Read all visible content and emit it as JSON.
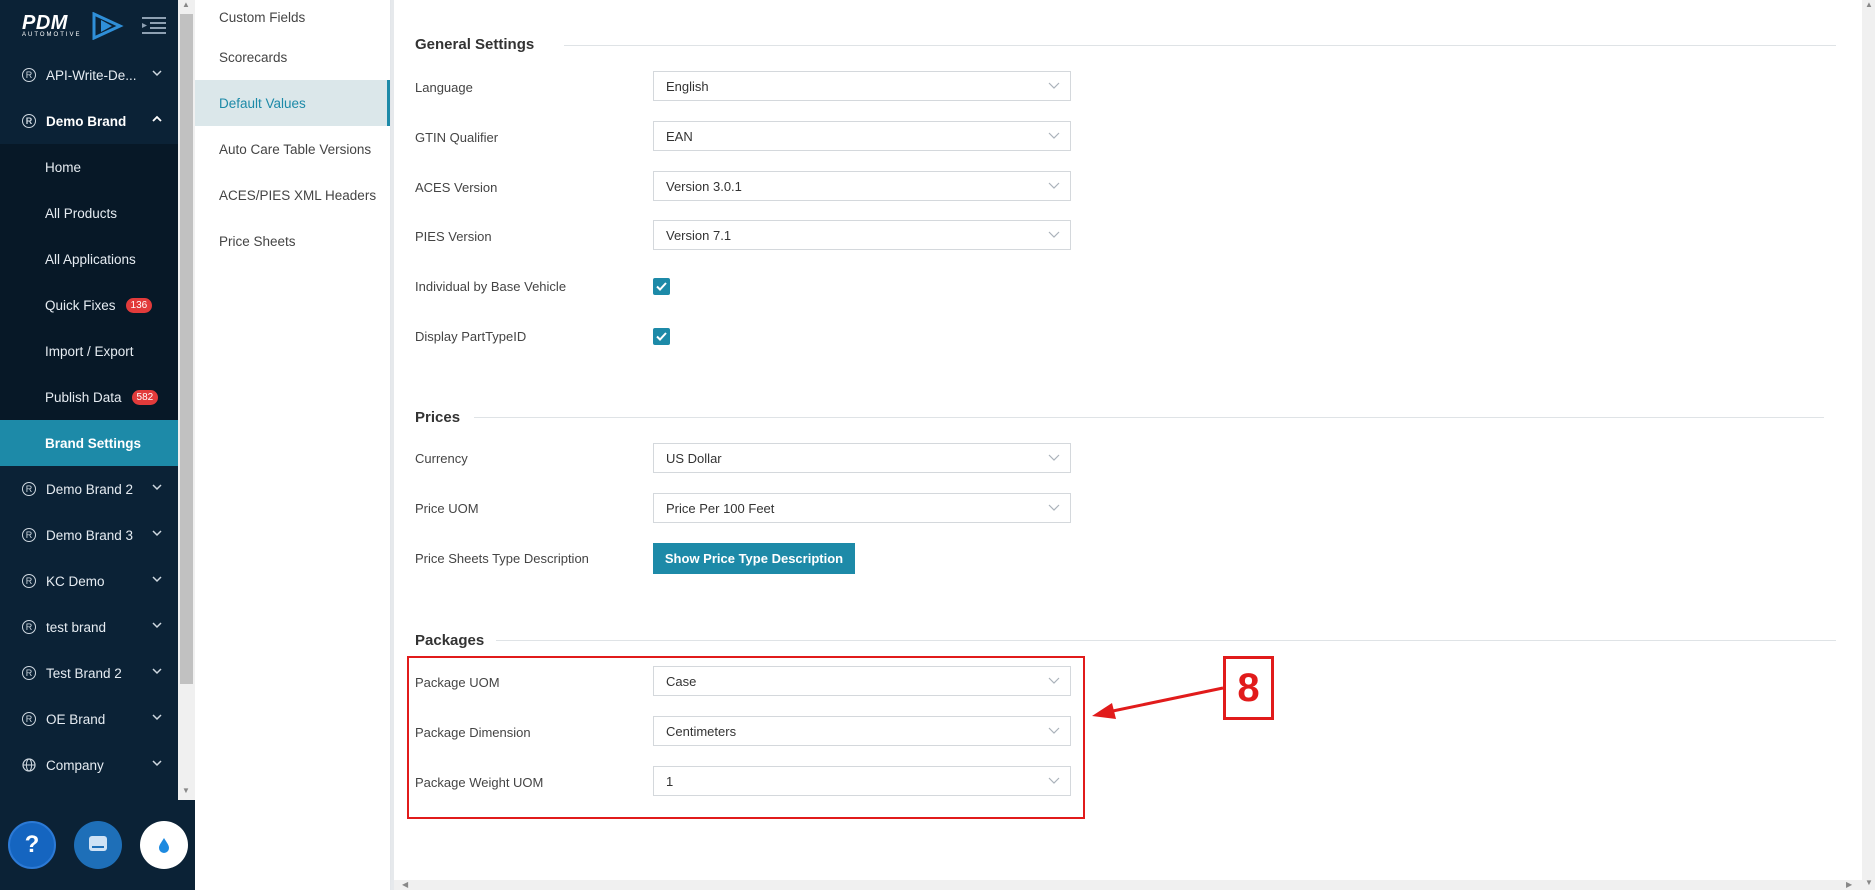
{
  "brand": {
    "logo_text": "PDM",
    "logo_sub": "AUTOMOTIVE"
  },
  "sidebar": {
    "brands_before": [
      {
        "label": "API-Write-De..."
      }
    ],
    "expanded_brand": {
      "label": "Demo Brand"
    },
    "sub_items": [
      {
        "label": "Home"
      },
      {
        "label": "All Products"
      },
      {
        "label": "All Applications"
      },
      {
        "label": "Quick Fixes",
        "badge": "136"
      },
      {
        "label": "Import / Export"
      },
      {
        "label": "Publish Data",
        "badge": "582"
      },
      {
        "label": "Brand Settings",
        "active": true
      }
    ],
    "brands_after": [
      {
        "label": "Demo Brand 2"
      },
      {
        "label": "Demo Brand 3"
      },
      {
        "label": "KC Demo"
      },
      {
        "label": "test brand"
      },
      {
        "label": "Test Brand 2"
      },
      {
        "label": "OE Brand"
      }
    ],
    "company": {
      "label": "Company"
    },
    "footer": {
      "help_label": "?"
    }
  },
  "submenu": {
    "items": [
      {
        "label": "Custom Fields"
      },
      {
        "label": "Scorecards"
      },
      {
        "label": "Default Values",
        "active": true
      },
      {
        "label": "Auto Care Table Versions"
      },
      {
        "label": "ACES/PIES XML Headers"
      },
      {
        "label": "Price Sheets"
      }
    ]
  },
  "general": {
    "title": "General Settings",
    "language_label": "Language",
    "language_value": "English",
    "gtin_label": "GTIN Qualifier",
    "gtin_value": "EAN",
    "aces_label": "ACES Version",
    "aces_value": "Version 3.0.1",
    "pies_label": "PIES Version",
    "pies_value": "Version 7.1",
    "individual_label": "Individual by Base Vehicle",
    "individual_checked": true,
    "parttype_label": "Display PartTypeID",
    "parttype_checked": true
  },
  "prices": {
    "title": "Prices",
    "currency_label": "Currency",
    "currency_value": "US Dollar",
    "uom_label": "Price UOM",
    "uom_value": "Price Per 100 Feet",
    "type_desc_label": "Price Sheets Type Description",
    "type_desc_button": "Show Price Type Description"
  },
  "packages": {
    "title": "Packages",
    "uom_label": "Package UOM",
    "uom_value": "Case",
    "dimension_label": "Package Dimension",
    "dimension_value": "Centimeters",
    "weight_label": "Package Weight UOM",
    "weight_value": "1"
  },
  "annotation": {
    "number": "8",
    "color": "#e11b1b"
  },
  "colors": {
    "accent": "#1d8aa8",
    "sidebar_bg": "#0b2236",
    "badge": "#e23b3b"
  }
}
